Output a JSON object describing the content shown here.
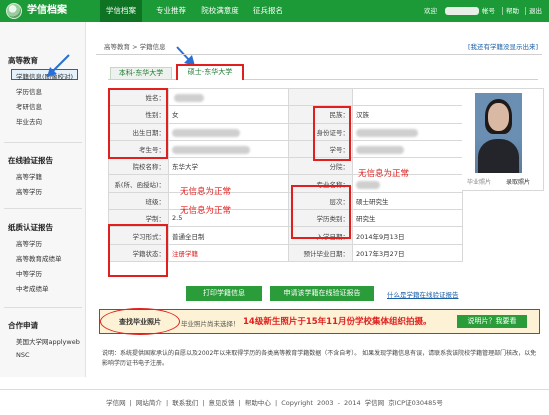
{
  "header": {
    "site_title": "学信档案",
    "nav": [
      "学信档案",
      "专业推荐",
      "院校满意度",
      "征兵报名"
    ],
    "welcome": "欢迎",
    "account": "帐号",
    "help": "帮助",
    "exit": "退出"
  },
  "sidebar": {
    "sections": [
      {
        "title": "高等教育",
        "items": [
          "学籍信息(图像校对)",
          "学历信息",
          "考研信息",
          "毕业去向"
        ]
      },
      {
        "title": "在线验证报告",
        "items": [
          "高等学籍",
          "高等学历"
        ]
      },
      {
        "title": "纸质认证报告",
        "items": [
          "高等学历",
          "高等教育成绩单",
          "中等学历",
          "中考成绩单"
        ]
      },
      {
        "title": "合作申请",
        "items": [
          "美国大学网applyweb",
          "NSC"
        ]
      }
    ]
  },
  "breadcrumb": "高等教育 > 学籍信息",
  "ask_link": "[我还有学籍没显示出来]",
  "tabs": [
    "本科-东华大学",
    "硕士-东华大学"
  ],
  "info": {
    "labels": {
      "name": "姓名：",
      "gender": "性别：",
      "birth": "出生日期：",
      "exam_no": "考生号：",
      "school": "院校名称：",
      "dept": "系(所、函授站)：",
      "class": "班级：",
      "duration": "学制：",
      "form": "学习形式：",
      "status": "学籍状态：",
      "ethnic": "民族：",
      "id_card": "身份证号：",
      "student_no": "学号：",
      "branch": "分院：",
      "major": "专业名称：",
      "level": "层次：",
      "category": "学历类别：",
      "enroll_date": "入学日期：",
      "grad_date": "预计毕业日期："
    },
    "values": {
      "gender": "女",
      "school": "东华大学",
      "duration": "2.5",
      "form": "普通全日制",
      "status": "注册学籍",
      "ethnic": "汉族",
      "level": "硕士研究生",
      "category": "研究生",
      "enroll_date": "2014年9月13日",
      "grad_date": "2017年3月27日"
    },
    "notes": {
      "dept": "无信息为正常",
      "class": "无信息为正常",
      "student_no": "无信息为正常"
    }
  },
  "photo": {
    "graduation_label": "毕业照片",
    "admission_label": "录取照片"
  },
  "actions": {
    "print": "打印学籍信息",
    "apply": "申请该学籍在线验证报告",
    "print_link": "什么是学籍在线验证报告"
  },
  "notice": {
    "pill": "查找毕业照片",
    "small": "毕业照片尚未选择！",
    "big": "14级新生照片于15年11月份学校集体组织拍摄。",
    "button": "说明片？我要看"
  },
  "description": "说明：系统提供国家承认的自愿以及2002年以来取得学历的各类高等教育学籍数据（不含自考）。  如果发现学籍信息有误，请联系我该院校学籍管理部门核改，以免影响学历证书电子注册。",
  "footer": [
    "学信网",
    "网站简介",
    "联系我们",
    "意见反馈",
    "帮助中心",
    "Copyright 2003 - 2014  学信网  京ICP证030485号"
  ],
  "colors": {
    "brand_green": "#1b9a37",
    "highlight_red": "#e0201f",
    "link_blue": "#1a5fa6",
    "annotation_blue": "#2a6fd6"
  }
}
